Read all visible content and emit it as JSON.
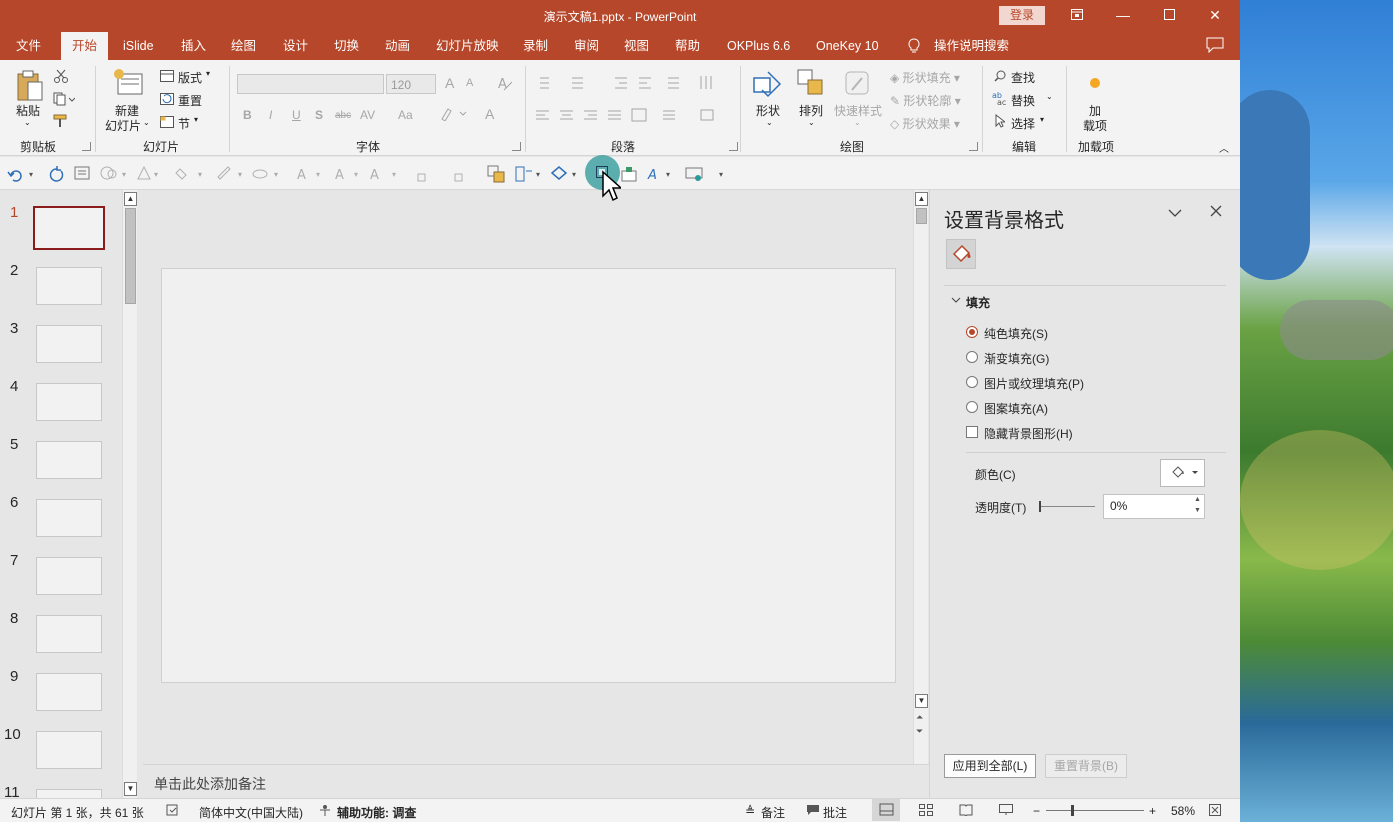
{
  "window": {
    "title": "演示文稿1.pptx  -  PowerPoint",
    "login_label": "登录",
    "colors": {
      "accent": "#b7472a",
      "ribbon_bg": "#f3f3f3",
      "selected_thumb": "#8a1c1c",
      "highlight": "#2a9a9a"
    }
  },
  "tabs": [
    {
      "label": "文件"
    },
    {
      "label": "开始"
    },
    {
      "label": "iSlide"
    },
    {
      "label": "插入"
    },
    {
      "label": "绘图"
    },
    {
      "label": "设计"
    },
    {
      "label": "切换"
    },
    {
      "label": "动画"
    },
    {
      "label": "幻灯片放映"
    },
    {
      "label": "录制"
    },
    {
      "label": "审阅"
    },
    {
      "label": "视图"
    },
    {
      "label": "帮助"
    },
    {
      "label": "OKPlus 6.6"
    },
    {
      "label": "OneKey 10"
    },
    {
      "label": "操作说明搜索"
    }
  ],
  "ribbon": {
    "clipboard": {
      "label": "剪贴板",
      "paste": "粘贴"
    },
    "slides": {
      "label": "幻灯片",
      "new_slide_1": "新建",
      "new_slide_2": "幻灯片",
      "layout": "版式",
      "reset": "重置",
      "section": "节"
    },
    "font": {
      "label": "字体",
      "font_size": "120",
      "bold": "B",
      "italic": "I",
      "underline": "U",
      "shadow": "S",
      "strike": "abc",
      "spacing": "AV",
      "case": "Aa",
      "grow": "A",
      "shrink": "A",
      "color": "A"
    },
    "paragraph": {
      "label": "段落"
    },
    "drawing": {
      "label": "绘图",
      "shapes": "形状",
      "arrange": "排列",
      "quick_styles": "快速样式",
      "shape_fill": "形状填充",
      "shape_outline": "形状轮廓",
      "shape_effects": "形状效果"
    },
    "editing": {
      "label": "编辑",
      "find": "查找",
      "replace": "替换",
      "select": "选择"
    },
    "addins": {
      "label": "加载项",
      "addin_1": "加",
      "addin_2": "载项"
    }
  },
  "slides": {
    "numbers": [
      "1",
      "2",
      "3",
      "4",
      "5",
      "6",
      "7",
      "8",
      "9",
      "10",
      "11"
    ]
  },
  "notes_placeholder": "单击此处添加备注",
  "format_pane": {
    "title": "设置背景格式",
    "section": "填充",
    "options": [
      {
        "label": "纯色填充(S)",
        "checked": true
      },
      {
        "label": "渐变填充(G)",
        "checked": false
      },
      {
        "label": "图片或纹理填充(P)",
        "checked": false
      },
      {
        "label": "图案填充(A)",
        "checked": false
      }
    ],
    "hide_graphics": "隐藏背景图形(H)",
    "color_label": "颜色(C)",
    "transparency_label": "透明度(T)",
    "transparency_value": "0%",
    "apply_all": "应用到全部(L)",
    "reset_bg": "重置背景(B)"
  },
  "statusbar": {
    "slide_info": "幻灯片 第 1 张，共 61 张",
    "language": "简体中文(中国大陆)",
    "accessibility": "辅助功能: 调查",
    "notes": "备注",
    "comments": "批注",
    "zoom": "58%"
  }
}
